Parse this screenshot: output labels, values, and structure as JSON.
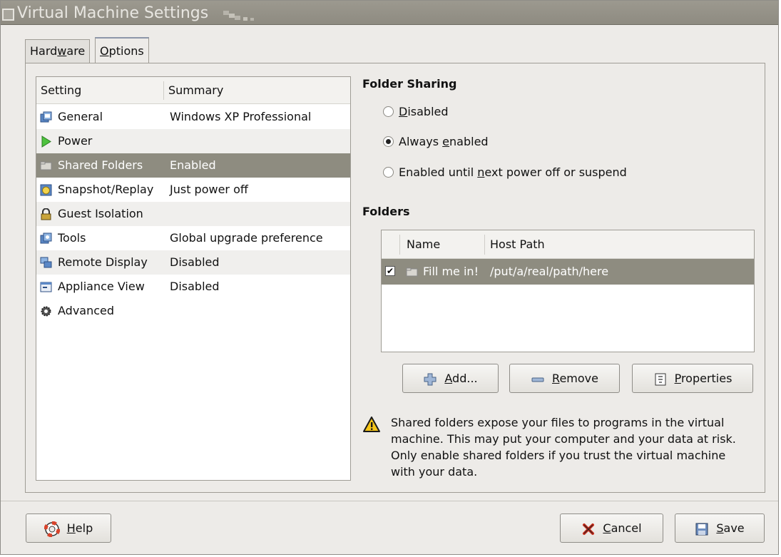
{
  "window": {
    "title": "Virtual Machine Settings"
  },
  "tabs": [
    {
      "pre": "Hard",
      "key": "w",
      "post": "are"
    },
    {
      "pre": "",
      "key": "O",
      "post": "ptions"
    }
  ],
  "settings_list": {
    "columns": [
      "Setting",
      "Summary"
    ],
    "rows": [
      {
        "name": "General",
        "summary": "Windows XP Professional"
      },
      {
        "name": "Power",
        "summary": ""
      },
      {
        "name": "Shared Folders",
        "summary": "Enabled"
      },
      {
        "name": "Snapshot/Replay",
        "summary": "Just power off"
      },
      {
        "name": "Guest Isolation",
        "summary": ""
      },
      {
        "name": "Tools",
        "summary": "Global upgrade preference"
      },
      {
        "name": "Remote Display",
        "summary": "Disabled"
      },
      {
        "name": "Appliance View",
        "summary": "Disabled"
      },
      {
        "name": "Advanced",
        "summary": ""
      }
    ]
  },
  "folder_sharing": {
    "title": "Folder Sharing",
    "options": [
      {
        "pre": "",
        "key": "D",
        "post": "isabled"
      },
      {
        "pre": "Always ",
        "key": "e",
        "post": "nabled"
      },
      {
        "pre": "Enabled until ",
        "key": "n",
        "post": "ext power off or suspend"
      }
    ]
  },
  "folders": {
    "title": "Folders",
    "columns": [
      "Name",
      "Host Path"
    ],
    "rows": [
      {
        "name": "Fill me in!",
        "host_path": "/put/a/real/path/here"
      }
    ],
    "buttons": {
      "add": {
        "key": "A",
        "post": "dd..."
      },
      "remove": {
        "key": "R",
        "post": "emove"
      },
      "properties": {
        "key": "P",
        "post": "roperties"
      }
    }
  },
  "warning": "Shared folders expose your files to programs in the virtual machine. This may put your computer and your data at risk. Only enable shared folders if you trust the virtual machine with your data.",
  "footer": {
    "help": {
      "key": "H",
      "post": "elp"
    },
    "cancel": {
      "key": "C",
      "post": "ancel"
    },
    "save": {
      "key": "S",
      "post": "ave"
    }
  },
  "colors": {
    "selection": "#8e8c80",
    "titlebar": "#9c998f",
    "warning": "#f5c518"
  }
}
